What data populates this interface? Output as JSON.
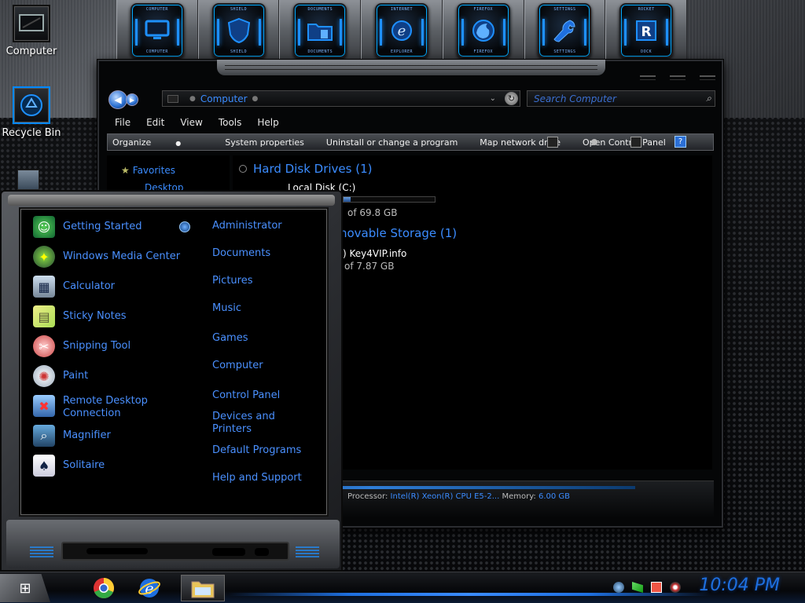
{
  "desktop": {
    "icons": [
      {
        "label": "Computer"
      },
      {
        "label": "Recycle Bin"
      }
    ]
  },
  "dock": {
    "items": [
      {
        "name": "computer",
        "top_label": "COMPUTER",
        "bottom_label": "COMPUTER"
      },
      {
        "name": "shield",
        "top_label": "SHIELD",
        "bottom_label": "SHIELD"
      },
      {
        "name": "documents",
        "top_label": "DOCUMENTS",
        "bottom_label": "DOCUMENTS"
      },
      {
        "name": "internet-explorer",
        "top_label": "INTERNET",
        "bottom_label": "EXPLORER"
      },
      {
        "name": "firefox",
        "top_label": "FIREFOX",
        "bottom_label": "FIREFOX"
      },
      {
        "name": "settings",
        "top_label": "SETTINGS",
        "bottom_label": "SETTINGS"
      },
      {
        "name": "rocket-dock",
        "top_label": "ROCKET",
        "bottom_label": "DOCK"
      }
    ]
  },
  "explorer": {
    "address": {
      "crumb": "Computer"
    },
    "search": {
      "placeholder": "Search Computer"
    },
    "menu": [
      "File",
      "Edit",
      "View",
      "Tools",
      "Help"
    ],
    "commands": [
      "Organize",
      "System properties",
      "Uninstall or change a program",
      "Map network drive",
      "Open Control Panel"
    ],
    "nav": {
      "favorites": "Favorites",
      "desktop": "Desktop"
    },
    "groups": {
      "hdd": {
        "title": "Hard Disk Drives (1)",
        "drive_name": "Local Disk (C:)",
        "size_text": "of 69.8 GB",
        "used_fraction": 0.08
      },
      "removable": {
        "title": "novable Storage (1)",
        "drive_name": ") Key4VIP.info",
        "size_text": "of 7.87 GB"
      }
    },
    "details": {
      "processor_label": "Processor:",
      "processor_value": "Intel(R) Xeon(R) CPU E5-2...",
      "memory_label": "Memory:",
      "memory_value": "6.00 GB"
    }
  },
  "start_menu": {
    "programs": [
      {
        "label": "Getting Started",
        "icon": "getting-started-icon"
      },
      {
        "label": "Windows Media Center",
        "icon": "media-center-icon"
      },
      {
        "label": "Calculator",
        "icon": "calculator-icon"
      },
      {
        "label": "Sticky Notes",
        "icon": "sticky-notes-icon"
      },
      {
        "label": "Snipping Tool",
        "icon": "snipping-tool-icon"
      },
      {
        "label": "Paint",
        "icon": "paint-icon"
      },
      {
        "label": "Remote Desktop Connection",
        "icon": "remote-desktop-icon"
      },
      {
        "label": "Magnifier",
        "icon": "magnifier-icon"
      },
      {
        "label": "Solitaire",
        "icon": "solitaire-icon"
      }
    ],
    "links": [
      "Administrator",
      "Documents",
      "Pictures",
      "Music",
      "Games",
      "Computer",
      "Control Panel",
      "Devices and Printers",
      "Default Programs",
      "Help and Support"
    ]
  },
  "taskbar": {
    "clock": "10:04 PM",
    "pinned": [
      "chrome",
      "internet-explorer",
      "file-explorer"
    ]
  },
  "colors": {
    "accent": "#3b8cff",
    "glow": "#1e90ff"
  }
}
